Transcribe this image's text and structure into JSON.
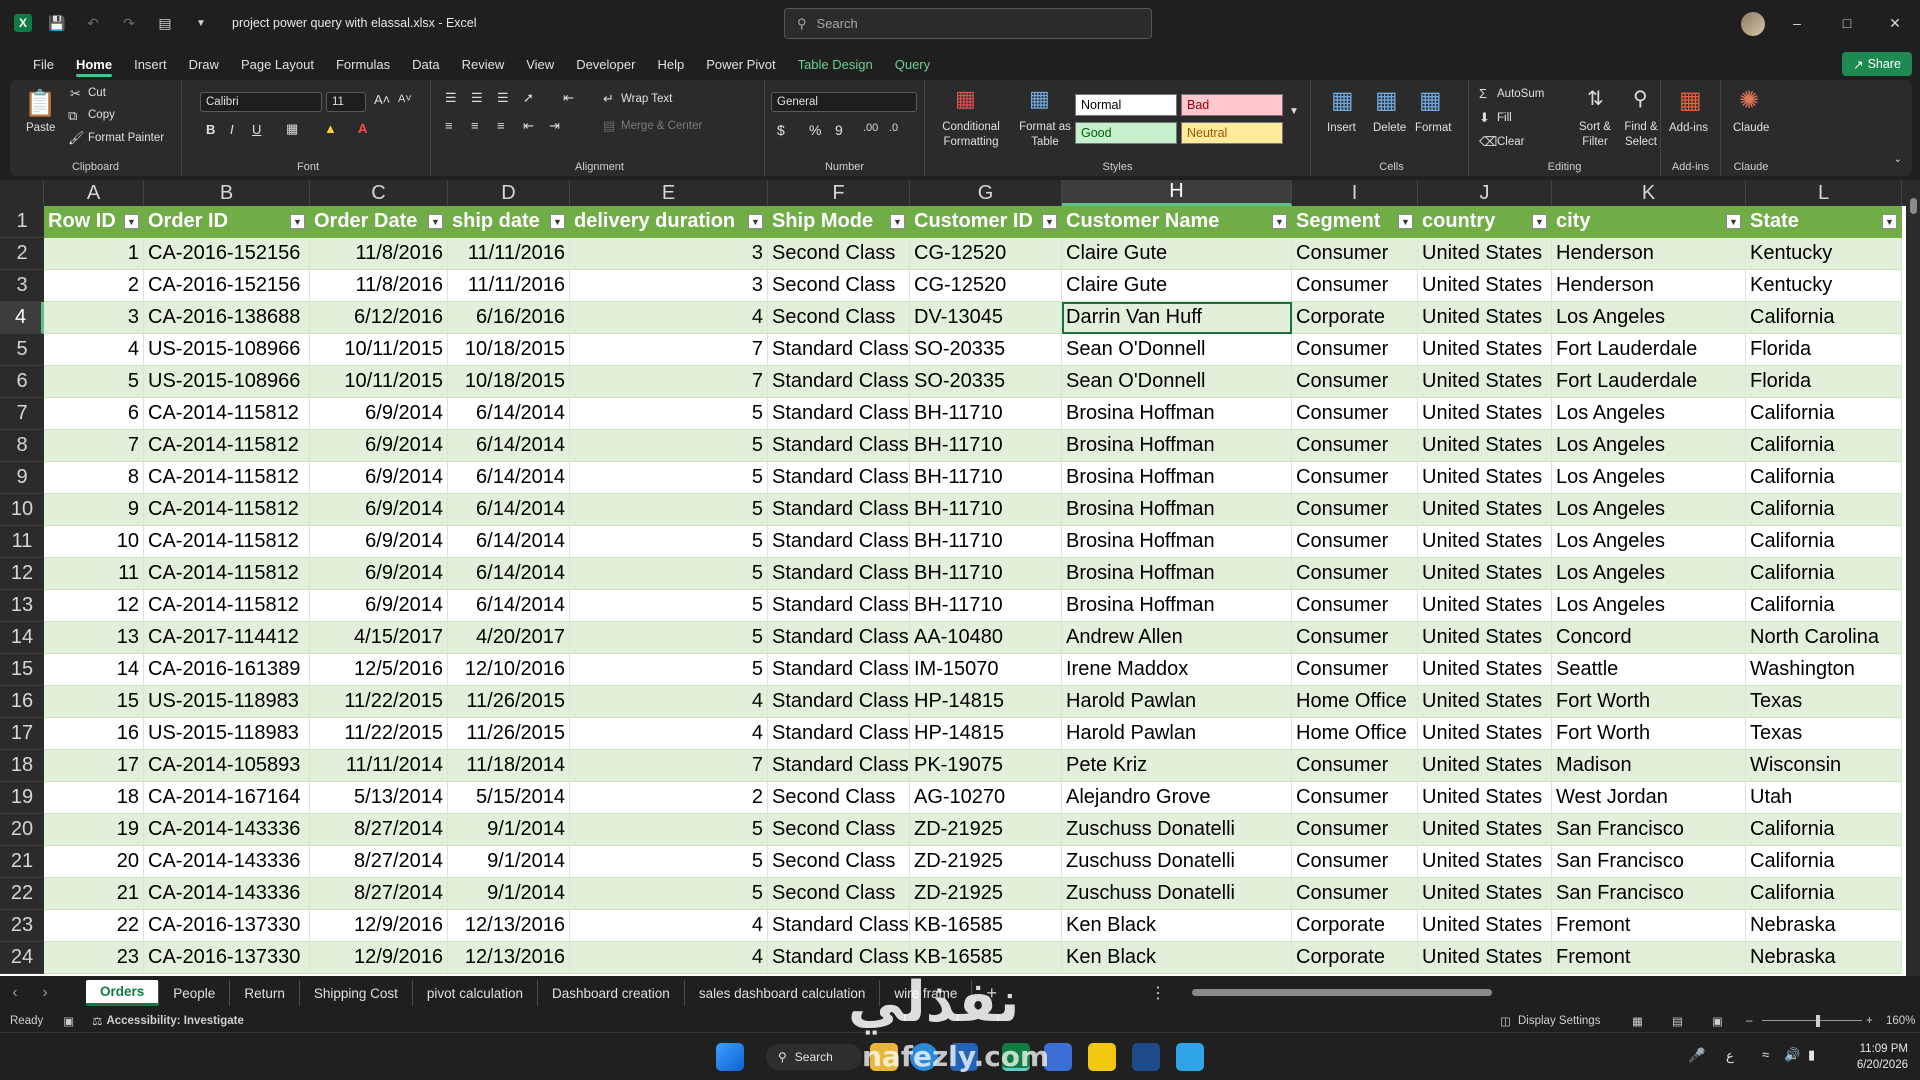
{
  "titlebar": {
    "doc_title": "project power query with elassal.xlsx  -  Excel",
    "search_placeholder": "Search"
  },
  "menu": {
    "items": [
      "File",
      "Home",
      "Insert",
      "Draw",
      "Page Layout",
      "Formulas",
      "Data",
      "Review",
      "View",
      "Developer",
      "Help",
      "Power Pivot",
      "Table Design",
      "Query"
    ],
    "active": "Home",
    "share": "Share"
  },
  "ribbon": {
    "clipboard": {
      "label": "Clipboard",
      "paste": "Paste",
      "cut": "Cut",
      "copy": "Copy",
      "format_painter": "Format Painter"
    },
    "font": {
      "label": "Font",
      "name": "Calibri",
      "size": "11",
      "bold": "B",
      "italic": "I",
      "underline": "U"
    },
    "alignment": {
      "label": "Alignment",
      "wrap_text": "Wrap Text",
      "merge_center": "Merge & Center"
    },
    "number": {
      "label": "Number",
      "format": "General",
      "currency": "$",
      "percent": "%",
      "comma": "9"
    },
    "styles": {
      "label": "Styles",
      "conditional": "Conditional Formatting",
      "format_table": "Format as Table",
      "normal": "Normal",
      "bad": "Bad",
      "good": "Good",
      "neutral": "Neutral"
    },
    "cells": {
      "label": "Cells",
      "insert": "Insert",
      "delete": "Delete",
      "format": "Format"
    },
    "editing": {
      "label": "Editing",
      "autosum": "AutoSum",
      "fill": "Fill",
      "clear": "Clear",
      "sort_filter": "Sort & Filter",
      "find_select": "Find & Select"
    },
    "addins": {
      "label": "Add-ins",
      "addins": "Add-ins"
    },
    "claude": {
      "label": "Claude",
      "claude": "Claude"
    }
  },
  "grid": {
    "columns": [
      "A",
      "B",
      "C",
      "D",
      "E",
      "F",
      "G",
      "H",
      "I",
      "J",
      "K",
      "L"
    ],
    "selected_column": "H",
    "selected_row": "4",
    "headers": [
      "Row ID",
      "Order ID",
      "Order Date",
      "ship date",
      "delivery duration",
      "Ship Mode",
      "Customer ID",
      "Customer Name",
      "Segment",
      "country",
      "city",
      "State"
    ],
    "rows": [
      [
        "1",
        "CA-2016-152156",
        "11/8/2016",
        "11/11/2016",
        "3",
        "Second Class",
        "CG-12520",
        "Claire Gute",
        "Consumer",
        "United States",
        "Henderson",
        "Kentucky"
      ],
      [
        "2",
        "CA-2016-152156",
        "11/8/2016",
        "11/11/2016",
        "3",
        "Second Class",
        "CG-12520",
        "Claire Gute",
        "Consumer",
        "United States",
        "Henderson",
        "Kentucky"
      ],
      [
        "3",
        "CA-2016-138688",
        "6/12/2016",
        "6/16/2016",
        "4",
        "Second Class",
        "DV-13045",
        "Darrin Van Huff",
        "Corporate",
        "United States",
        "Los Angeles",
        "California"
      ],
      [
        "4",
        "US-2015-108966",
        "10/11/2015",
        "10/18/2015",
        "7",
        "Standard Class",
        "SO-20335",
        "Sean O'Donnell",
        "Consumer",
        "United States",
        "Fort Lauderdale",
        "Florida"
      ],
      [
        "5",
        "US-2015-108966",
        "10/11/2015",
        "10/18/2015",
        "7",
        "Standard Class",
        "SO-20335",
        "Sean O'Donnell",
        "Consumer",
        "United States",
        "Fort Lauderdale",
        "Florida"
      ],
      [
        "6",
        "CA-2014-115812",
        "6/9/2014",
        "6/14/2014",
        "5",
        "Standard Class",
        "BH-11710",
        "Brosina Hoffman",
        "Consumer",
        "United States",
        "Los Angeles",
        "California"
      ],
      [
        "7",
        "CA-2014-115812",
        "6/9/2014",
        "6/14/2014",
        "5",
        "Standard Class",
        "BH-11710",
        "Brosina Hoffman",
        "Consumer",
        "United States",
        "Los Angeles",
        "California"
      ],
      [
        "8",
        "CA-2014-115812",
        "6/9/2014",
        "6/14/2014",
        "5",
        "Standard Class",
        "BH-11710",
        "Brosina Hoffman",
        "Consumer",
        "United States",
        "Los Angeles",
        "California"
      ],
      [
        "9",
        "CA-2014-115812",
        "6/9/2014",
        "6/14/2014",
        "5",
        "Standard Class",
        "BH-11710",
        "Brosina Hoffman",
        "Consumer",
        "United States",
        "Los Angeles",
        "California"
      ],
      [
        "10",
        "CA-2014-115812",
        "6/9/2014",
        "6/14/2014",
        "5",
        "Standard Class",
        "BH-11710",
        "Brosina Hoffman",
        "Consumer",
        "United States",
        "Los Angeles",
        "California"
      ],
      [
        "11",
        "CA-2014-115812",
        "6/9/2014",
        "6/14/2014",
        "5",
        "Standard Class",
        "BH-11710",
        "Brosina Hoffman",
        "Consumer",
        "United States",
        "Los Angeles",
        "California"
      ],
      [
        "12",
        "CA-2014-115812",
        "6/9/2014",
        "6/14/2014",
        "5",
        "Standard Class",
        "BH-11710",
        "Brosina Hoffman",
        "Consumer",
        "United States",
        "Los Angeles",
        "California"
      ],
      [
        "13",
        "CA-2017-114412",
        "4/15/2017",
        "4/20/2017",
        "5",
        "Standard Class",
        "AA-10480",
        "Andrew Allen",
        "Consumer",
        "United States",
        "Concord",
        "North Carolina"
      ],
      [
        "14",
        "CA-2016-161389",
        "12/5/2016",
        "12/10/2016",
        "5",
        "Standard Class",
        "IM-15070",
        "Irene Maddox",
        "Consumer",
        "United States",
        "Seattle",
        "Washington"
      ],
      [
        "15",
        "US-2015-118983",
        "11/22/2015",
        "11/26/2015",
        "4",
        "Standard Class",
        "HP-14815",
        "Harold Pawlan",
        "Home Office",
        "United States",
        "Fort Worth",
        "Texas"
      ],
      [
        "16",
        "US-2015-118983",
        "11/22/2015",
        "11/26/2015",
        "4",
        "Standard Class",
        "HP-14815",
        "Harold Pawlan",
        "Home Office",
        "United States",
        "Fort Worth",
        "Texas"
      ],
      [
        "17",
        "CA-2014-105893",
        "11/11/2014",
        "11/18/2014",
        "7",
        "Standard Class",
        "PK-19075",
        "Pete Kriz",
        "Consumer",
        "United States",
        "Madison",
        "Wisconsin"
      ],
      [
        "18",
        "CA-2014-167164",
        "5/13/2014",
        "5/15/2014",
        "2",
        "Second Class",
        "AG-10270",
        "Alejandro Grove",
        "Consumer",
        "United States",
        "West Jordan",
        "Utah"
      ],
      [
        "19",
        "CA-2014-143336",
        "8/27/2014",
        "9/1/2014",
        "5",
        "Second Class",
        "ZD-21925",
        "Zuschuss Donatelli",
        "Consumer",
        "United States",
        "San Francisco",
        "California"
      ],
      [
        "20",
        "CA-2014-143336",
        "8/27/2014",
        "9/1/2014",
        "5",
        "Second Class",
        "ZD-21925",
        "Zuschuss Donatelli",
        "Consumer",
        "United States",
        "San Francisco",
        "California"
      ],
      [
        "21",
        "CA-2014-143336",
        "8/27/2014",
        "9/1/2014",
        "5",
        "Second Class",
        "ZD-21925",
        "Zuschuss Donatelli",
        "Consumer",
        "United States",
        "San Francisco",
        "California"
      ],
      [
        "22",
        "CA-2016-137330",
        "12/9/2016",
        "12/13/2016",
        "4",
        "Standard Class",
        "KB-16585",
        "Ken Black",
        "Corporate",
        "United States",
        "Fremont",
        "Nebraska"
      ],
      [
        "23",
        "CA-2016-137330",
        "12/9/2016",
        "12/13/2016",
        "4",
        "Standard Class",
        "KB-16585",
        "Ken Black",
        "Corporate",
        "United States",
        "Fremont",
        "Nebraska"
      ]
    ]
  },
  "sheets": {
    "tabs": [
      "Orders",
      "People",
      "Return",
      "Shipping Cost",
      "pivot calculation",
      "Dashboard creation",
      "sales dashboard calculation",
      "wire frame"
    ],
    "active": "Orders"
  },
  "status": {
    "ready": "Ready",
    "accessibility": "Accessibility: Investigate",
    "display_settings": "Display Settings",
    "zoom": "160%"
  },
  "taskbar": {
    "search": "Search",
    "time": "11:09 PM",
    "date": "6/20/2026",
    "lang": "ع"
  },
  "watermark": {
    "arabic": "نفذلي",
    "latin": "nafezly.com"
  },
  "colors": {
    "header_green": "#70ad47",
    "band_green": "#e2efda",
    "accent": "#107c41"
  }
}
